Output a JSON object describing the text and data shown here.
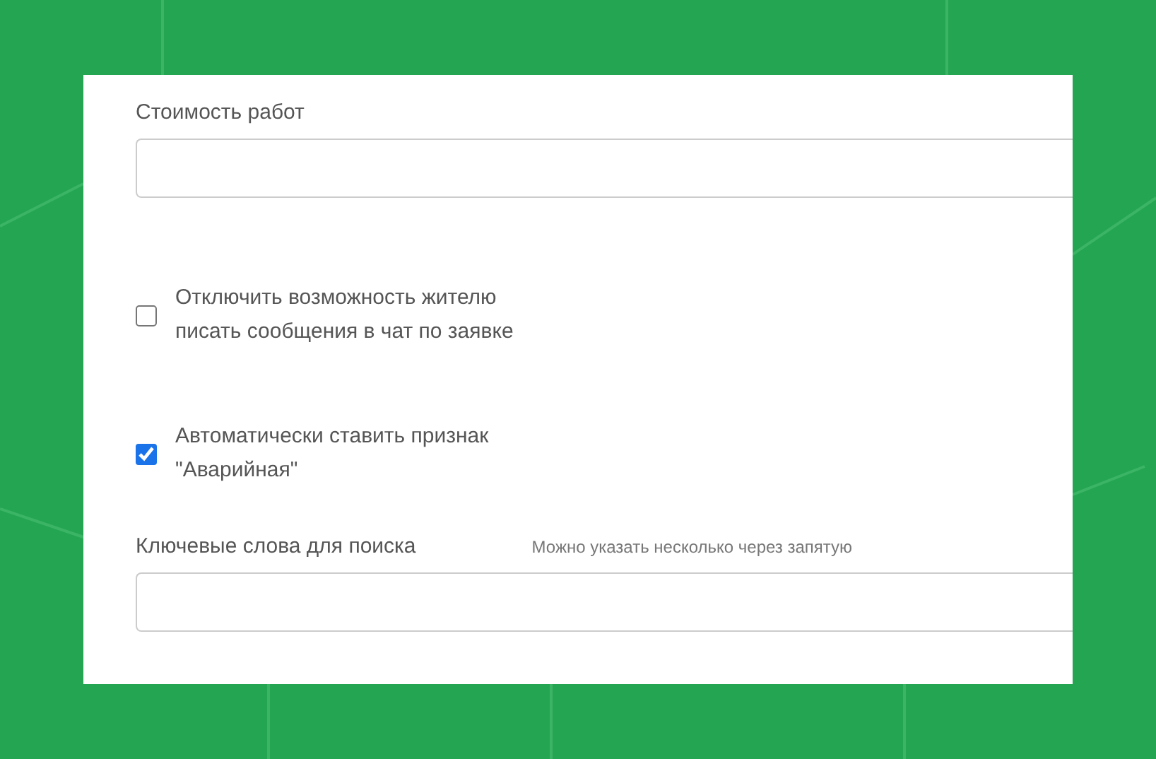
{
  "form": {
    "cost_field": {
      "label": "Стоимость работ"
    },
    "checkboxes": [
      {
        "label": "Отключить возможность жителю писать сообщения в чат по заявке",
        "checked": false
      },
      {
        "label": "Автоматически ставить признак \"Аварийная\"",
        "checked": true
      }
    ],
    "keywords_field": {
      "label": "Ключевые слова для поиска",
      "hint": "Можно указать несколько через запятую"
    }
  }
}
